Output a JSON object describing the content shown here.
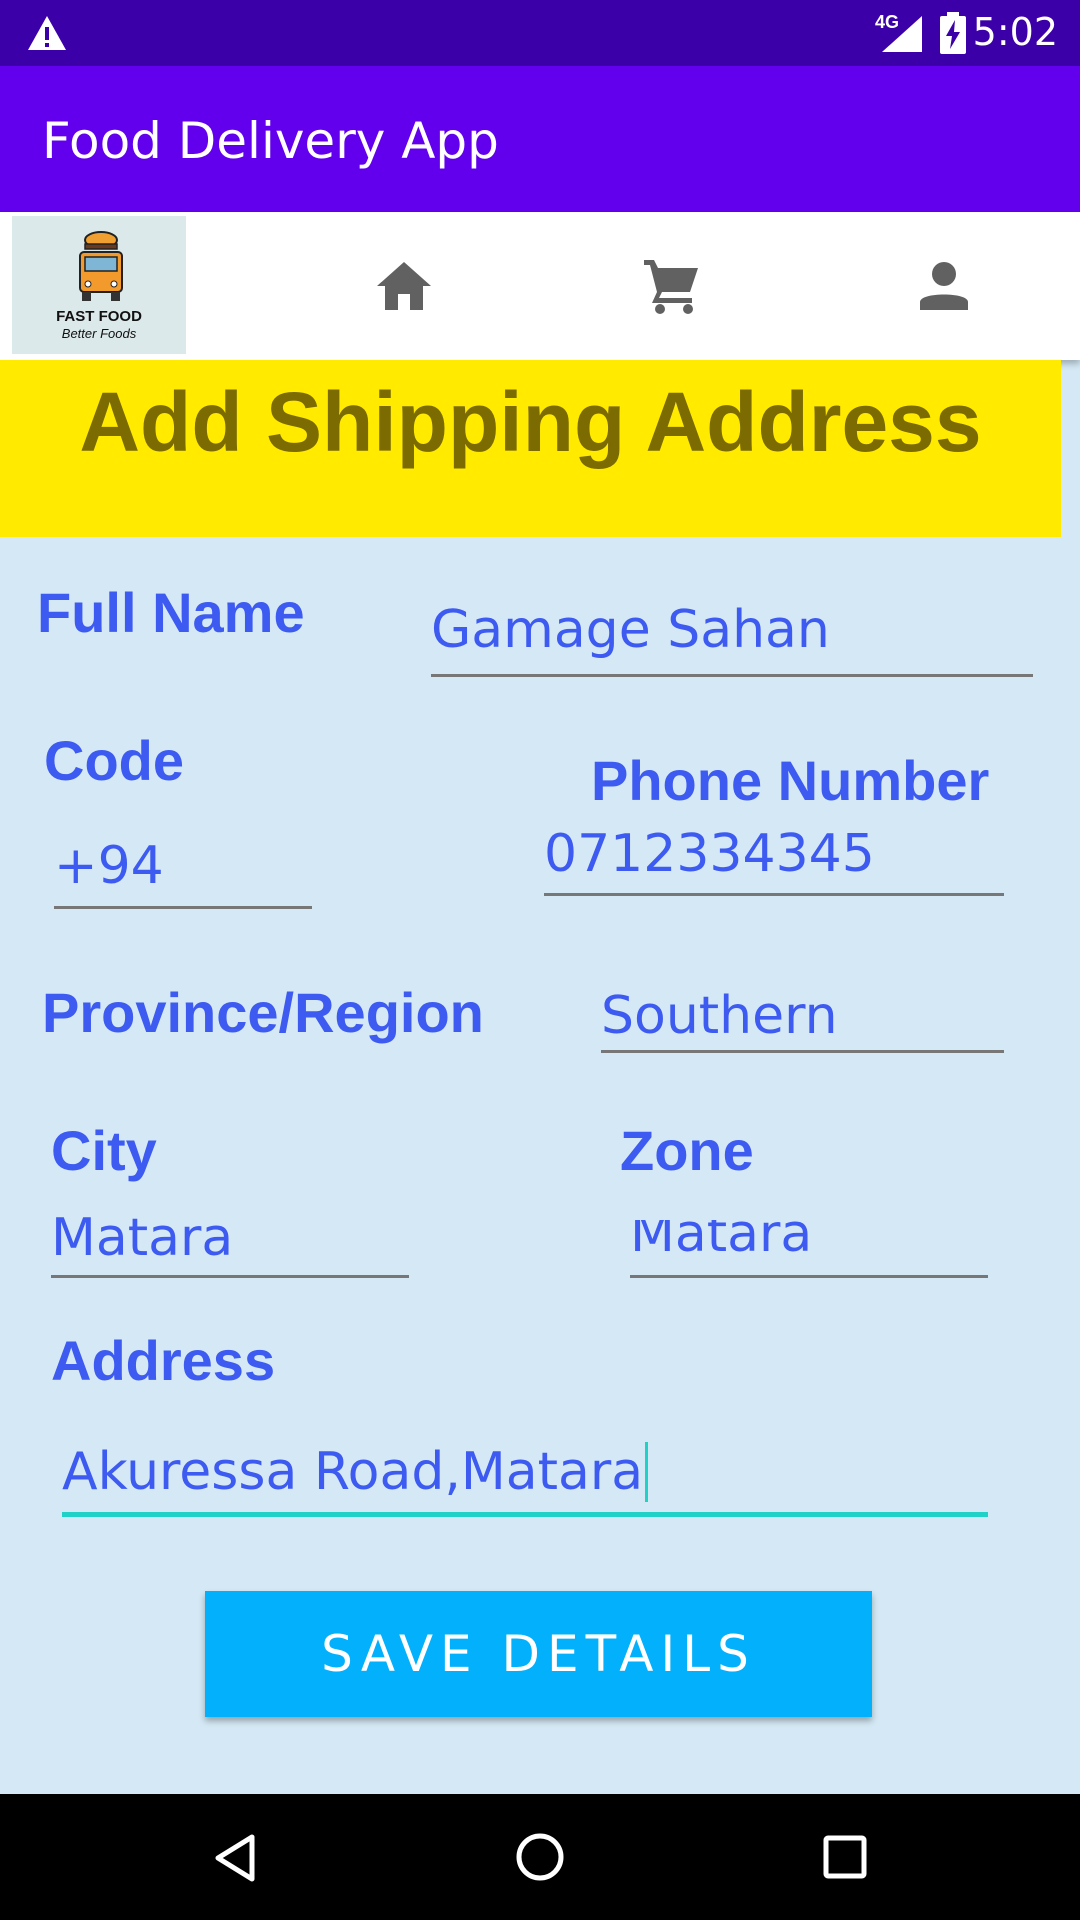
{
  "status_bar": {
    "network": "4G",
    "time": "5:02"
  },
  "app_bar": {
    "title": "Food Delivery App"
  },
  "nav": {
    "logo_line1": "FAST FOOD",
    "logo_line2": "Better Foods",
    "icons": [
      "home-icon",
      "cart-icon",
      "profile-icon"
    ]
  },
  "banner": {
    "title": "Add Shipping Address"
  },
  "form": {
    "full_name": {
      "label": "Full Name",
      "value": "Gamage Sahan"
    },
    "code": {
      "label": "Code",
      "value": "+94"
    },
    "phone": {
      "label": "Phone Number",
      "value": "0712334345"
    },
    "province": {
      "label": "Province/Region",
      "value": "Southern"
    },
    "city": {
      "label": "City",
      "value": "Matara"
    },
    "zone": {
      "label": "Zone",
      "value": "Matara"
    },
    "address": {
      "label": "Address",
      "value": "Akuressa Road,Matara"
    }
  },
  "save_button": {
    "label": "SAVE DETAILS"
  },
  "colors": {
    "accent": "#6200ee",
    "status": "#3c00a8",
    "banner": "#ffea00",
    "label": "#3d5af1",
    "button": "#03b0fc",
    "focus": "#1fd1c7"
  }
}
